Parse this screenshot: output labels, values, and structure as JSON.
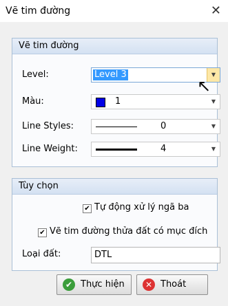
{
  "window": {
    "title": "Vẽ tim đường",
    "close_glyph": "✕"
  },
  "group1": {
    "title": "Vẽ tim đường",
    "level_label": "Level:",
    "level_value": "Level 3",
    "color_label": "Màu:",
    "color_value": "1",
    "color_swatch": "#0000e6",
    "line_styles_label": "Line Styles:",
    "line_styles_value": "0",
    "line_weight_label": "Line Weight:",
    "line_weight_value": "4"
  },
  "group2": {
    "title": "Tùy chọn",
    "auto_label": "Tự động xử lý ngã ba",
    "auto_checked": true,
    "draw_label": "Vẽ tim đường thửa đất có mục đích",
    "draw_checked": true,
    "land_label": "Loại đất:",
    "land_value": "DTL"
  },
  "buttons": {
    "ok_label": "Thực hiện",
    "exit_label": "Thoát"
  }
}
